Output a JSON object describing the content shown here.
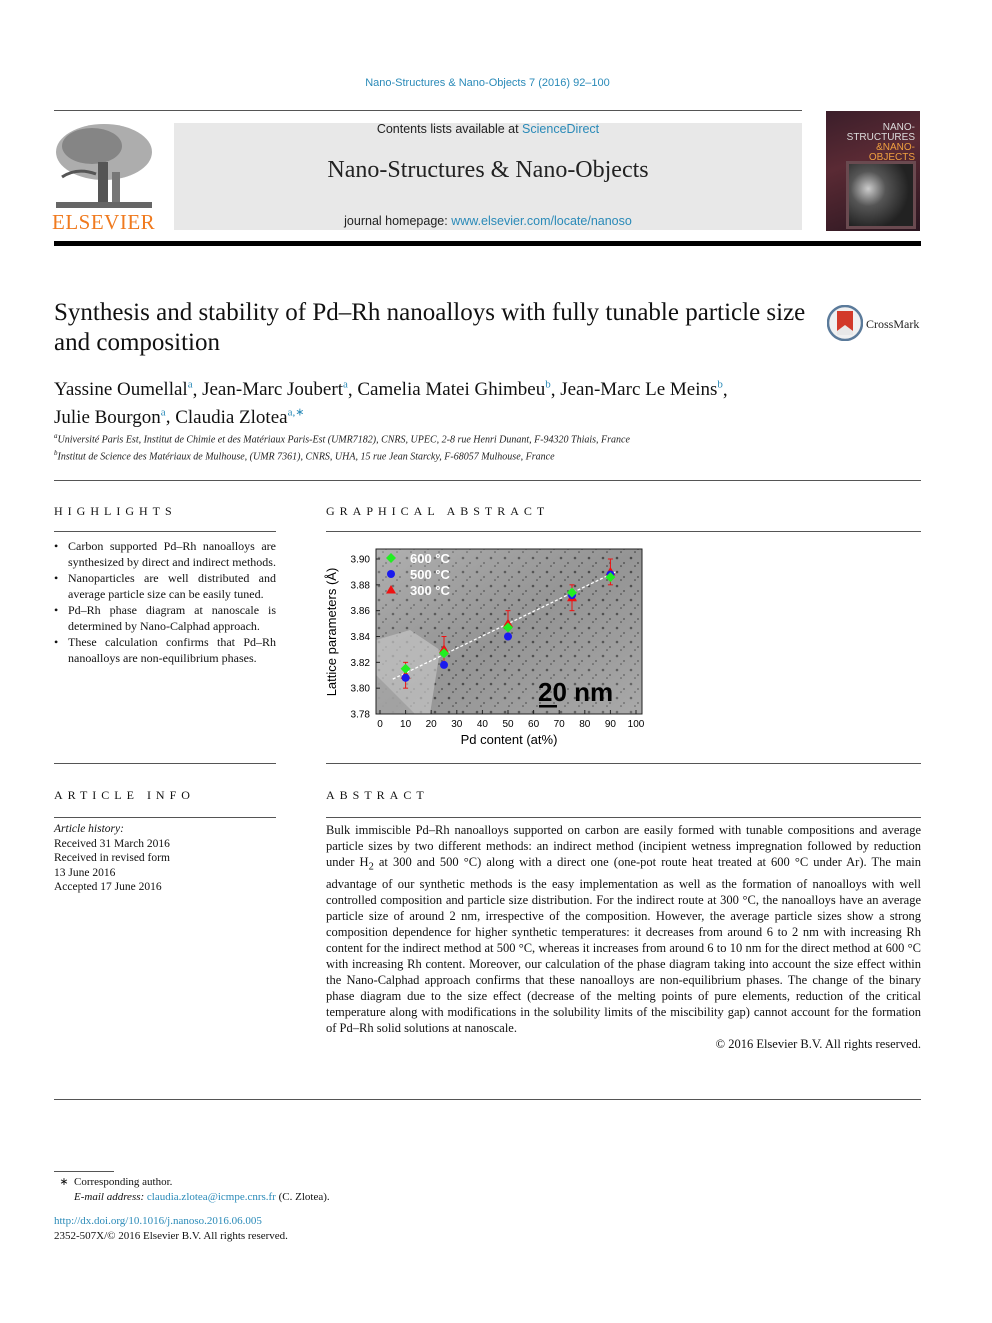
{
  "header": {
    "journal_ref": "Nano-Structures & Nano-Objects 7 (2016) 92–100",
    "contents_prefix": "Contents lists available at ",
    "contents_link": "ScienceDirect",
    "journal_title": "Nano-Structures & Nano-Objects",
    "homepage_prefix": "journal homepage: ",
    "homepage_link": "www.elsevier.com/locate/nanoso",
    "publisher_logo": "ELSEVIER",
    "cover": {
      "line1": "NANO-",
      "line2": "STRUCTURES",
      "line3": "&NANO-",
      "line4": "OBJECTS"
    }
  },
  "article": {
    "title": "Synthesis and stability of Pd–Rh nanoalloys with fully tunable particle size and composition",
    "crossmark_label": "CrossMark",
    "authors": [
      {
        "name": "Yassine Oumellal",
        "sup": "a"
      },
      {
        "name": "Jean-Marc Joubert",
        "sup": "a"
      },
      {
        "name": "Camelia Matei Ghimbeu",
        "sup": "b"
      },
      {
        "name": "Jean-Marc Le Meins",
        "sup": "b"
      },
      {
        "name": "Julie Bourgon",
        "sup": "a"
      },
      {
        "name": "Claudia Zlotea",
        "sup": "a,∗"
      }
    ],
    "affiliations": [
      {
        "sup": "a",
        "text": "Université Paris Est, Institut de Chimie et des Matériaux Paris-Est (UMR7182), CNRS, UPEC, 2-8 rue Henri Dunant, F-94320 Thiais, France"
      },
      {
        "sup": "b",
        "text": "Institut de Science des Matériaux de Mulhouse, (UMR 7361), CNRS, UHA, 15 rue Jean Starcky, F-68057 Mulhouse, France"
      }
    ]
  },
  "highlights": {
    "heading": "HIGHLIGHTS",
    "items": [
      "Carbon supported Pd–Rh nanoalloys are synthesized by direct and indirect methods.",
      "Nanoparticles are well distributed and average particle size can be easily tuned.",
      "Pd–Rh phase diagram at nanoscale is determined by Nano-Calphad approach.",
      "These calculation confirms that Pd–Rh nanoalloys are non-equilibrium phases."
    ]
  },
  "graphical_abstract": {
    "heading": "GRAPHICAL ABSTRACT",
    "scale_bar": "20 nm"
  },
  "chart_data": {
    "type": "scatter",
    "title": "",
    "xlabel": "Pd content (at%)",
    "ylabel": "Lattice parameters (Å)",
    "xlim": [
      0,
      100
    ],
    "ylim": [
      3.78,
      3.9
    ],
    "xticks": [
      "0",
      "10",
      "20",
      "30",
      "40",
      "50",
      "60",
      "70",
      "80",
      "90",
      "100"
    ],
    "yticks": [
      "3.78",
      "3.80",
      "3.82",
      "3.84",
      "3.86",
      "3.88",
      "3.90"
    ],
    "legend_position": "top-left",
    "x": [
      10,
      25,
      50,
      75,
      90
    ],
    "series": [
      {
        "name": "600 °C",
        "marker": "diamond",
        "color": "#22ee22",
        "values": [
          3.815,
          3.827,
          3.847,
          3.874,
          3.886
        ]
      },
      {
        "name": "500 °C",
        "marker": "circle",
        "color": "#1a1aee",
        "values": [
          3.808,
          3.818,
          3.84,
          3.872,
          3.888
        ]
      },
      {
        "name": "300 °C",
        "marker": "triangle",
        "color": "#ee1111",
        "values": [
          3.81,
          3.83,
          3.85,
          3.87,
          3.89
        ],
        "error": 0.01
      }
    ],
    "trendline": {
      "x": [
        5,
        92
      ],
      "y": [
        3.807,
        3.89
      ]
    }
  },
  "article_info": {
    "heading": "ARTICLE INFO",
    "history_label": "Article history:",
    "lines": [
      "Received 31 March 2016",
      "Received in revised form",
      "13 June 2016",
      "Accepted 17 June 2016"
    ]
  },
  "abstract": {
    "heading": "ABSTRACT",
    "text_1": "Bulk immiscible Pd–Rh nanoalloys supported on carbon are easily formed with tunable compositions and average particle sizes by two different methods: an indirect method (incipient wetness impregnation followed by reduction under H",
    "sub": "2",
    "text_2": " at 300 and 500 °C) along with a direct one (one-pot route heat treated at 600 °C under Ar). The main advantage of our synthetic methods is the easy implementation as well as the formation of nanoalloys with well controlled composition and particle size distribution. For the indirect route at 300 °C, the nanoalloys have an average particle size of around 2 nm, irrespective of the composition. However, the average particle sizes show a strong composition dependence for higher synthetic temperatures: it decreases from around 6 to 2 nm with increasing Rh content for the indirect method at 500 °C, whereas it increases from around 6 to 10 nm for the direct method at 600 °C with increasing Rh content. Moreover, our calculation of the phase diagram taking into account the size effect within the Nano-Calphad approach confirms that these nanoalloys are non-equilibrium phases. The change of the binary phase diagram due to the size effect (decrease of the melting points of pure elements, reduction of the critical temperature along with modifications in the solubility limits of the miscibility gap) cannot account for the formation of Pd–Rh solid solutions at nanoscale.",
    "copyright": "© 2016 Elsevier B.V. All rights reserved."
  },
  "footer": {
    "star": "∗",
    "corresponding": "Corresponding author.",
    "email_label": "E-mail address:",
    "email": "claudia.zlotea@icmpe.cnrs.fr",
    "email_suffix": " (C. Zlotea).",
    "doi": "http://dx.doi.org/10.1016/j.nanoso.2016.06.005",
    "issn": "2352-507X/© 2016 Elsevier B.V. All rights reserved."
  }
}
